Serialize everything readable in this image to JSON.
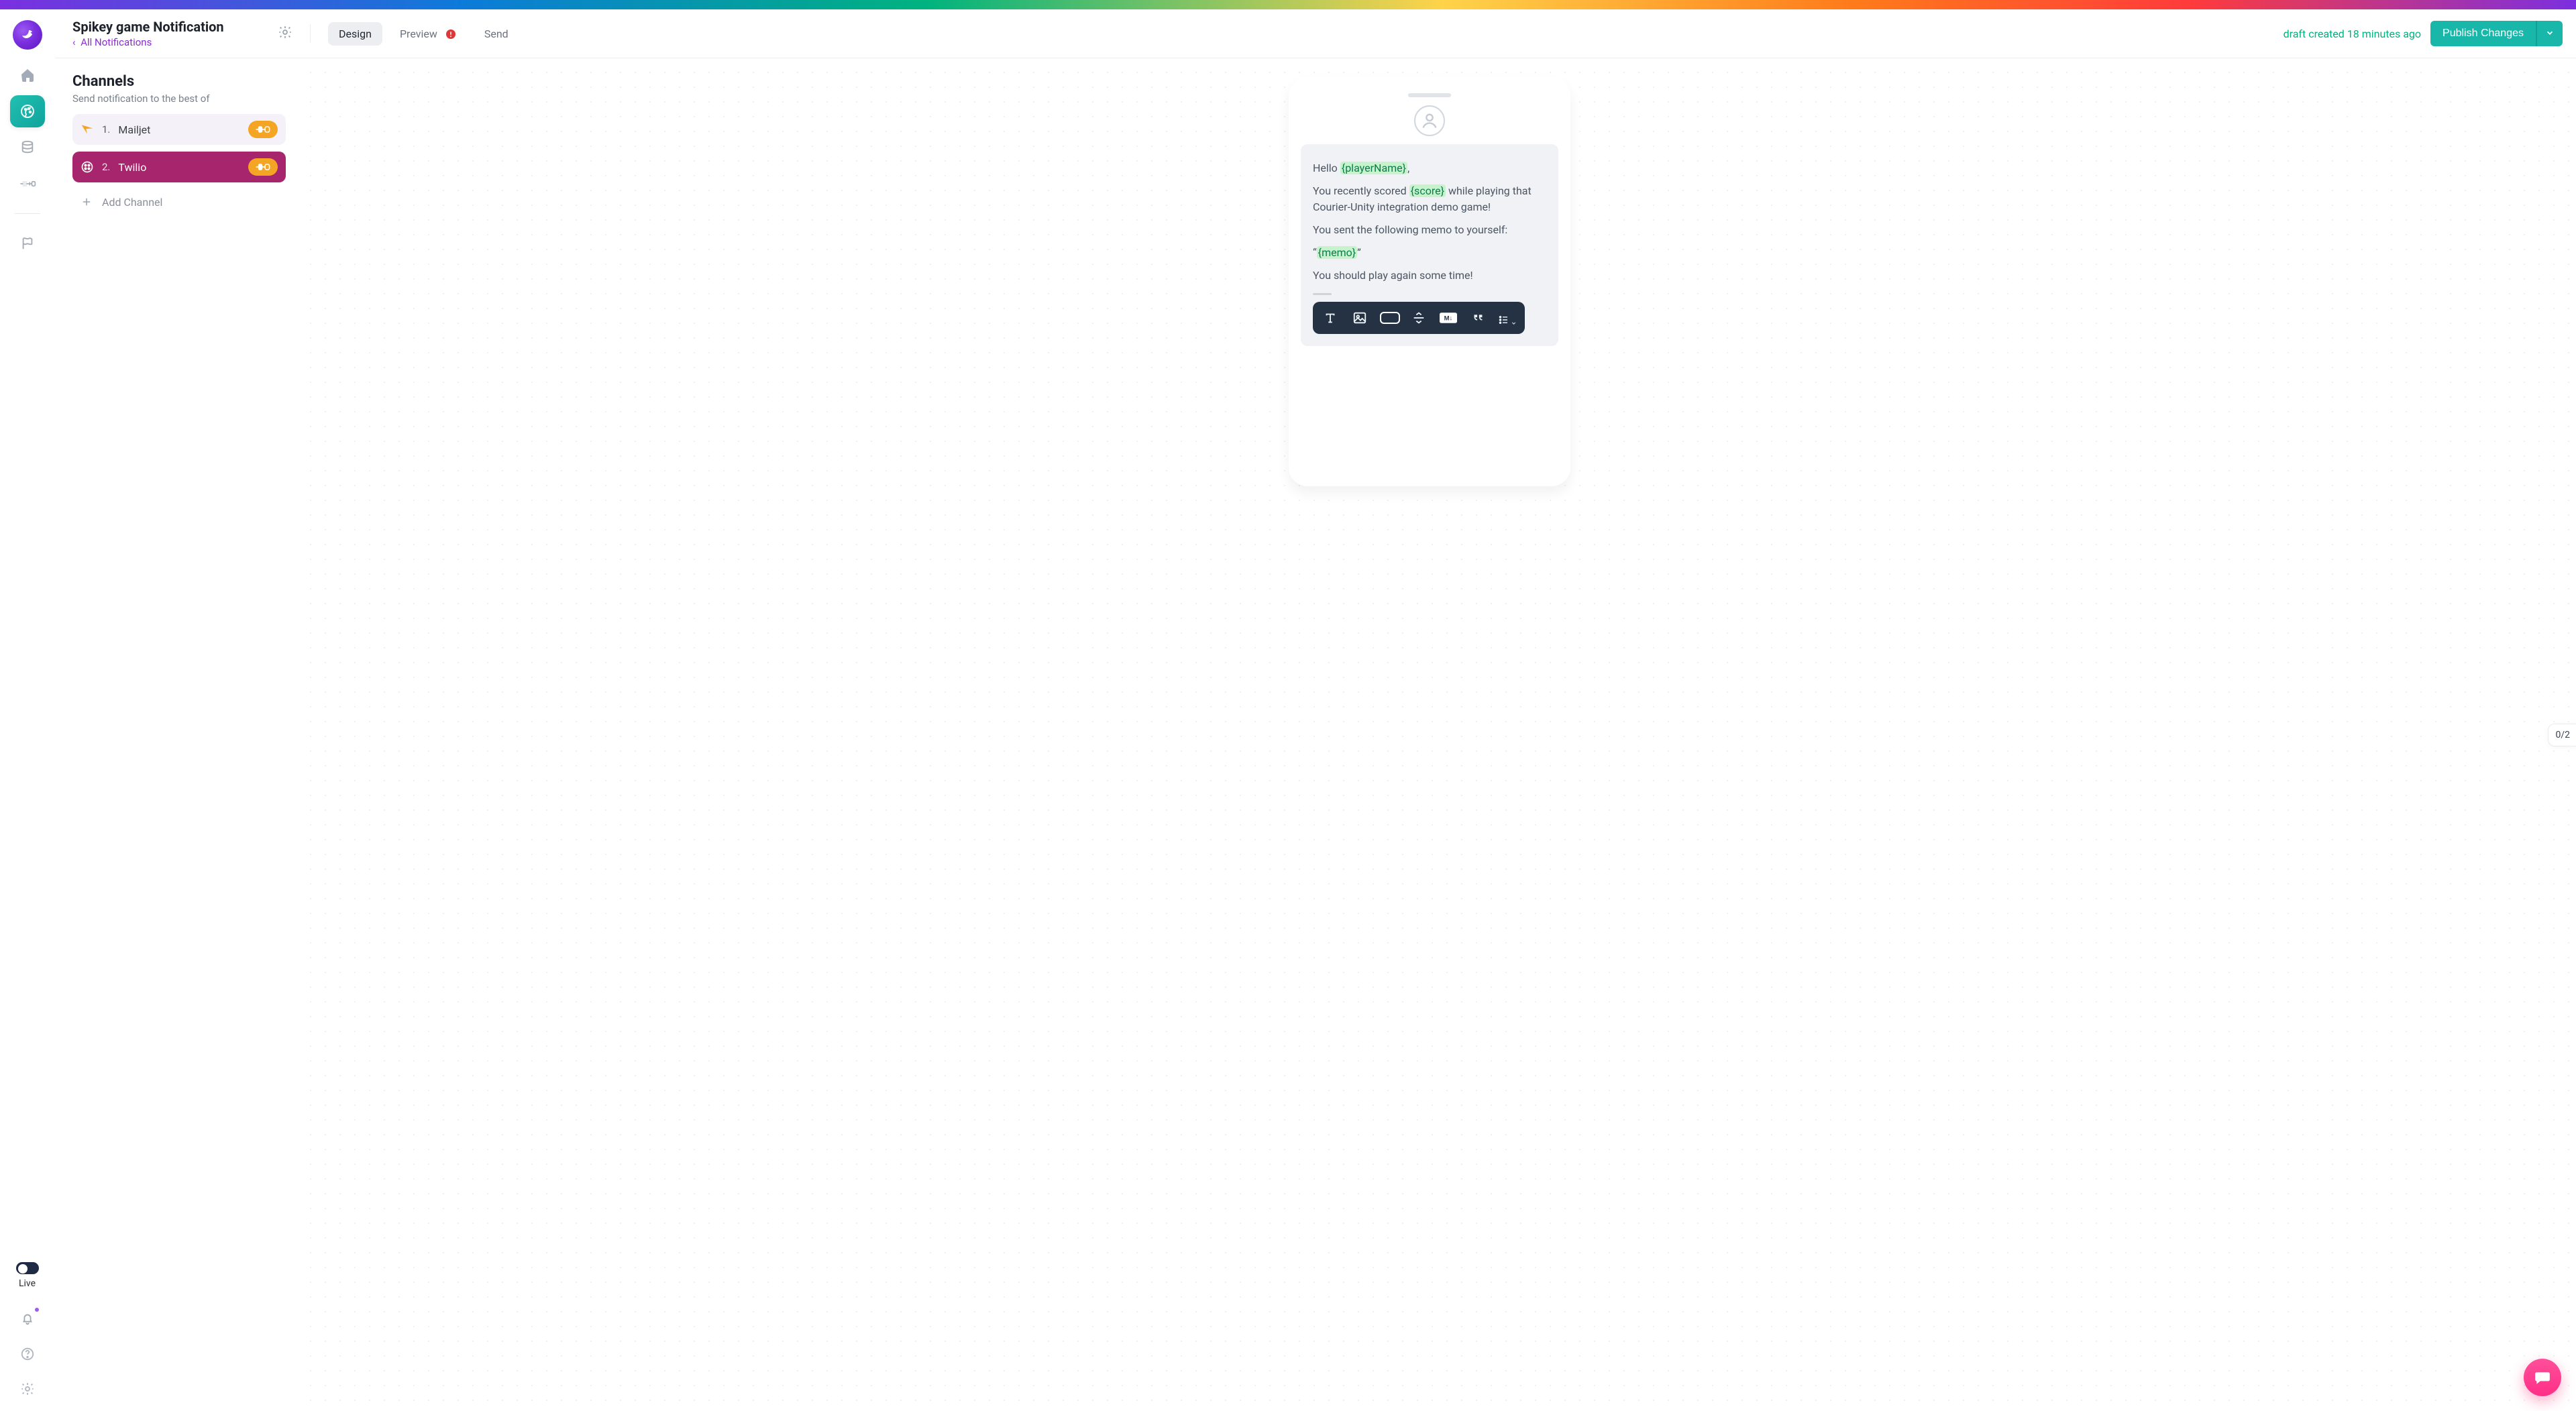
{
  "header": {
    "title": "Spikey game Notification",
    "back_label": "All Notifications",
    "tabs": {
      "design": "Design",
      "preview": "Preview",
      "send": "Send"
    },
    "draft_status": "draft created 18 minutes ago",
    "publish_label": "Publish Changes"
  },
  "sidebar": {
    "items": {
      "home": "home",
      "design": "design",
      "data": "data",
      "integrations": "integrations",
      "flags": "flags"
    },
    "live_label": "Live"
  },
  "channels": {
    "heading": "Channels",
    "subtitle": "Send notification to the best of",
    "items": [
      {
        "index": "1.",
        "label": "Mailjet"
      },
      {
        "index": "2.",
        "label": "Twilio"
      }
    ],
    "add_label": "Add Channel"
  },
  "preview": {
    "p1_prefix": "Hello ",
    "p1_var": "{playerName}",
    "p1_suffix": ",",
    "p2_prefix": "You recently scored ",
    "p2_var": "{score}",
    "p2_suffix": " while playing that Courier-Unity integration demo game!",
    "p3": "You sent the following memo to yourself:",
    "p4_q1": "“",
    "p4_var": "{memo}",
    "p4_q2": "”",
    "p5": "You should play again some time!"
  },
  "toolbar": {
    "text": "text",
    "image": "image",
    "button": "button",
    "divider": "divider",
    "markdown": "markdown",
    "quote": "quote",
    "list": "list"
  },
  "counter": "0/2"
}
